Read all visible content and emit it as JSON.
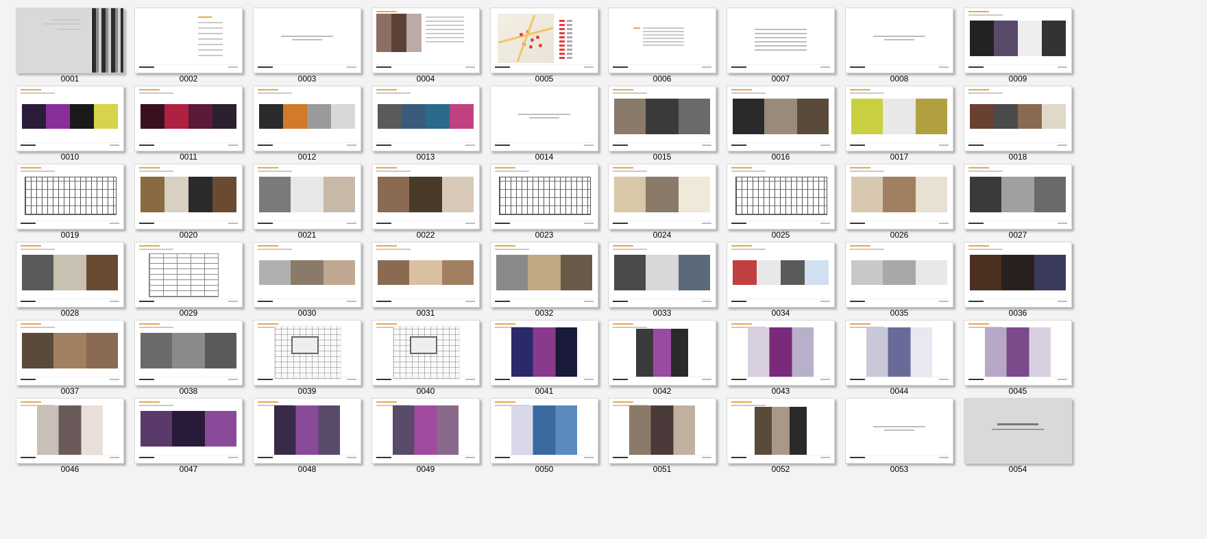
{
  "thumbnails": [
    {
      "label": "0001",
      "kind": "cover"
    },
    {
      "label": "0002",
      "kind": "toc"
    },
    {
      "label": "0003",
      "kind": "blank-title"
    },
    {
      "label": "0004",
      "kind": "photo-text",
      "colors": [
        "#8d6e63",
        "#5d4037",
        "#bcaaa4"
      ]
    },
    {
      "label": "0005",
      "kind": "map"
    },
    {
      "label": "0006",
      "kind": "text"
    },
    {
      "label": "0007",
      "kind": "text-center"
    },
    {
      "label": "0008",
      "kind": "blank-title"
    },
    {
      "label": "0009",
      "kind": "strip-tall",
      "colors": [
        "#222",
        "#5a4a6a",
        "#eee",
        "#333"
      ]
    },
    {
      "label": "0010",
      "kind": "strip",
      "colors": [
        "#2b1c3a",
        "#8a2f9a",
        "#1a1a1a",
        "#d7d34a"
      ]
    },
    {
      "label": "0011",
      "kind": "strip",
      "colors": [
        "#3a1020",
        "#b02040",
        "#5a1a3a",
        "#2a2030"
      ]
    },
    {
      "label": "0012",
      "kind": "strip",
      "colors": [
        "#2b2b2b",
        "#d07a2a",
        "#9a9a9a",
        "#d8d8d8"
      ]
    },
    {
      "label": "0013",
      "kind": "strip",
      "colors": [
        "#5a5a5a",
        "#3a5a7a",
        "#2a6a8a",
        "#c04080"
      ]
    },
    {
      "label": "0014",
      "kind": "blank-title"
    },
    {
      "label": "0015",
      "kind": "strip-tall",
      "colors": [
        "#8a7a6a",
        "#3a3a3a",
        "#6a6a6a"
      ]
    },
    {
      "label": "0016",
      "kind": "strip-tall",
      "colors": [
        "#2a2a2a",
        "#9a8a7a",
        "#5a4a3a"
      ]
    },
    {
      "label": "0017",
      "kind": "strip-tall",
      "colors": [
        "#c8d040",
        "#e8e8e8",
        "#b0a040"
      ]
    },
    {
      "label": "0018",
      "kind": "strip",
      "colors": [
        "#6a4030",
        "#4a4a4a",
        "#8a6a50",
        "#e0d8c8"
      ]
    },
    {
      "label": "0019",
      "kind": "drawing"
    },
    {
      "label": "0020",
      "kind": "strip-tall",
      "colors": [
        "#8a6a40",
        "#d8d0c0",
        "#2a2a2a",
        "#6a4a30"
      ]
    },
    {
      "label": "0021",
      "kind": "strip-tall",
      "colors": [
        "#7a7a7a",
        "#e8e8e8",
        "#c8b8a8"
      ]
    },
    {
      "label": "0022",
      "kind": "strip-tall",
      "colors": [
        "#8a6a50",
        "#4a3a2a",
        "#d8c8b8"
      ]
    },
    {
      "label": "0023",
      "kind": "drawing"
    },
    {
      "label": "0024",
      "kind": "strip-tall",
      "colors": [
        "#d8c8a8",
        "#8a7a6a",
        "#f0e8d8"
      ]
    },
    {
      "label": "0025",
      "kind": "drawing"
    },
    {
      "label": "0026",
      "kind": "strip-tall",
      "colors": [
        "#d8c8b0",
        "#a08060",
        "#e8e0d0"
      ]
    },
    {
      "label": "0027",
      "kind": "strip-tall",
      "colors": [
        "#3a3a3a",
        "#a0a0a0",
        "#6a6a6a"
      ]
    },
    {
      "label": "0028",
      "kind": "strip-tall",
      "colors": [
        "#5a5a5a",
        "#c8c0b0",
        "#6a4a30"
      ]
    },
    {
      "label": "0029",
      "kind": "table"
    },
    {
      "label": "0030",
      "kind": "strip",
      "colors": [
        "#b0b0b0",
        "#8a7a6a",
        "#c0a890"
      ]
    },
    {
      "label": "0031",
      "kind": "strip",
      "colors": [
        "#8a6a50",
        "#d8c0a0",
        "#a08060"
      ]
    },
    {
      "label": "0032",
      "kind": "strip-tall",
      "colors": [
        "#8a8a8a",
        "#c0a880",
        "#6a5a4a"
      ]
    },
    {
      "label": "0033",
      "kind": "strip-tall",
      "colors": [
        "#4a4a4a",
        "#d8d8d8",
        "#5a6a7a"
      ]
    },
    {
      "label": "0034",
      "kind": "strip",
      "colors": [
        "#c04040",
        "#e8e8e8",
        "#5a5a5a",
        "#d0e0f0"
      ]
    },
    {
      "label": "0035",
      "kind": "strip",
      "colors": [
        "#c8c8c8",
        "#a8a8a8",
        "#e8e8e8"
      ]
    },
    {
      "label": "0036",
      "kind": "strip-tall",
      "colors": [
        "#4a3020",
        "#2a2020",
        "#3a3a5a"
      ]
    },
    {
      "label": "0037",
      "kind": "strip-tall",
      "colors": [
        "#5a4a3a",
        "#a08060",
        "#8a6a50"
      ]
    },
    {
      "label": "0038",
      "kind": "strip-tall",
      "colors": [
        "#6a6a6a",
        "#8a8a8a",
        "#5a5a5a"
      ]
    },
    {
      "label": "0039",
      "kind": "plan"
    },
    {
      "label": "0040",
      "kind": "plan"
    },
    {
      "label": "0041",
      "kind": "photo",
      "colors": [
        "#2a2a6a",
        "#8a3a8a",
        "#1a1a3a"
      ]
    },
    {
      "label": "0042",
      "kind": "photo-mid",
      "colors": [
        "#3a3a3a",
        "#9a4aa0",
        "#2a2a2a"
      ]
    },
    {
      "label": "0043",
      "kind": "photo",
      "colors": [
        "#d8d0e0",
        "#7a2a7a",
        "#b8b0c8"
      ]
    },
    {
      "label": "0044",
      "kind": "photo",
      "colors": [
        "#c8c8d8",
        "#6a6a9a",
        "#e8e8f0"
      ]
    },
    {
      "label": "0045",
      "kind": "photo",
      "colors": [
        "#b8a8c8",
        "#7a4a8a",
        "#d8d0e0"
      ]
    },
    {
      "label": "0046",
      "kind": "photo",
      "colors": [
        "#c8c0b8",
        "#6a5a5a",
        "#e8e0d8"
      ]
    },
    {
      "label": "0047",
      "kind": "strip-tall",
      "colors": [
        "#5a3a6a",
        "#2a1a3a",
        "#8a4a9a"
      ]
    },
    {
      "label": "0048",
      "kind": "photo",
      "colors": [
        "#3a2a4a",
        "#8a4a9a",
        "#5a4a6a"
      ]
    },
    {
      "label": "0049",
      "kind": "photo",
      "colors": [
        "#5a4a6a",
        "#a04aa0",
        "#8a6a8a"
      ]
    },
    {
      "label": "0050",
      "kind": "photo",
      "colors": [
        "#d8d8e8",
        "#3a6aa0",
        "#5a8ac0"
      ]
    },
    {
      "label": "0051",
      "kind": "photo",
      "colors": [
        "#8a7a6a",
        "#4a3a3a",
        "#c0b0a0"
      ]
    },
    {
      "label": "0052",
      "kind": "photo-mid",
      "colors": [
        "#5a4a3a",
        "#a89888",
        "#2a2a2a"
      ]
    },
    {
      "label": "0053",
      "kind": "blank-title"
    },
    {
      "label": "0054",
      "kind": "end"
    }
  ]
}
